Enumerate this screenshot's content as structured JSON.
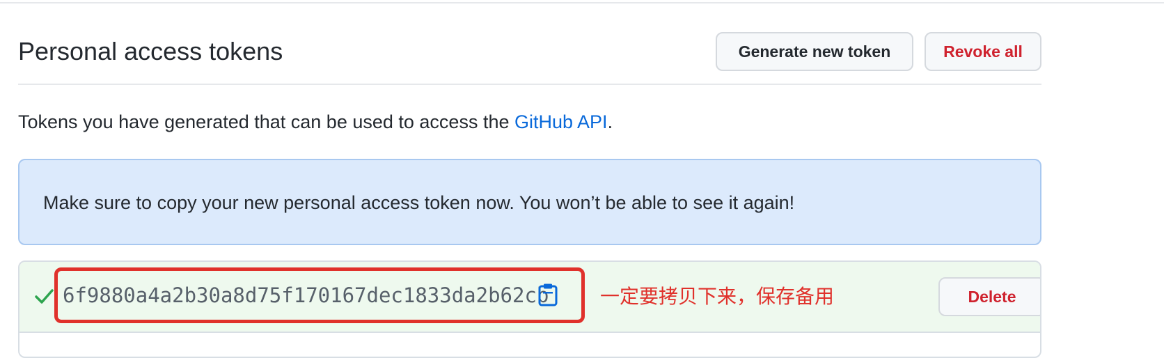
{
  "header": {
    "title": "Personal access tokens",
    "generate_label": "Generate new token",
    "revoke_label": "Revoke all"
  },
  "description": {
    "text_before": "Tokens you have generated that can be used to access the ",
    "link_text": "GitHub API",
    "text_after": "."
  },
  "flash": {
    "message": "Make sure to copy your new personal access token now. You won’t be able to see it again!"
  },
  "token": {
    "value": "6f9880a4a2b30a8d75f170167dec1833da2b62cb",
    "annotation": "一定要拷贝下来，保存备用",
    "delete_label": "Delete",
    "check_icon": "check-icon",
    "copy_icon": "clipboard-icon"
  },
  "colors": {
    "accent_blue": "#0969da",
    "danger_red": "#cf222e",
    "annotation_red": "#e0312b",
    "success_green": "#2da44e"
  }
}
